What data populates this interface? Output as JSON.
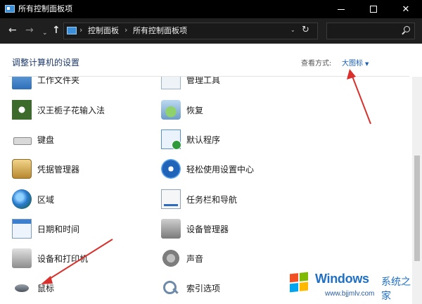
{
  "window": {
    "title": "所有控制面板项",
    "controls": {
      "minimize": "—",
      "maximize": "☐",
      "close": "✕"
    }
  },
  "nav": {
    "back": "←",
    "forward": "→",
    "recent": "⌄",
    "up": "↑",
    "breadcrumb": [
      "控制面板",
      "所有控制面板项"
    ],
    "breadcrumb_separator": "›",
    "dropdown": "⌄",
    "refresh": "↻",
    "search_placeholder": ""
  },
  "header": {
    "title": "调整计算机的设置",
    "view_by_label": "查看方式:",
    "view_by_value": "大图标",
    "view_by_caret": "▼"
  },
  "items_left": [
    {
      "label": "工作文件夹",
      "icon": "work-folders-icon"
    },
    {
      "label": "汉王栀子花输入法",
      "icon": "input-method-icon"
    },
    {
      "label": "键盘",
      "icon": "keyboard-icon"
    },
    {
      "label": "凭据管理器",
      "icon": "credential-manager-icon"
    },
    {
      "label": "区域",
      "icon": "region-globe-icon"
    },
    {
      "label": "日期和时间",
      "icon": "calendar-clock-icon"
    },
    {
      "label": "设备和打印机",
      "icon": "printer-icon"
    },
    {
      "label": "鼠标",
      "icon": "mouse-icon"
    }
  ],
  "items_right": [
    {
      "label": "管理工具",
      "icon": "admin-tools-icon"
    },
    {
      "label": "恢复",
      "icon": "recovery-icon"
    },
    {
      "label": "默认程序",
      "icon": "default-programs-icon"
    },
    {
      "label": "轻松使用设置中心",
      "icon": "ease-of-access-icon"
    },
    {
      "label": "任务栏和导航",
      "icon": "taskbar-icon"
    },
    {
      "label": "设备管理器",
      "icon": "device-manager-icon"
    },
    {
      "label": "声音",
      "icon": "speaker-icon"
    },
    {
      "label": "索引选项",
      "icon": "indexing-magnifier-icon"
    }
  ],
  "annotations": {
    "arrow_color": "#d9302c"
  },
  "watermark": {
    "brand": "Windows",
    "suffix": "系统之家",
    "url": "www.bjjmlv.com",
    "logo_colors": [
      "#f25022",
      "#7fba00",
      "#00a4ef",
      "#ffb900"
    ]
  }
}
